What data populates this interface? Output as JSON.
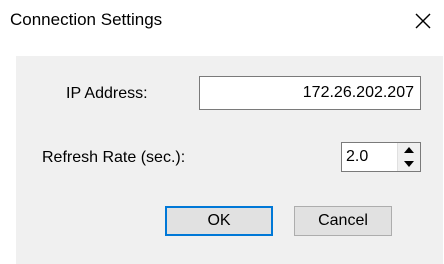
{
  "window": {
    "title": "Connection Settings",
    "close_icon": "close-x-icon"
  },
  "form": {
    "ip_label": "IP Address:",
    "ip_value": "172.26.202.207",
    "refresh_label": "Refresh Rate (sec.):",
    "refresh_value": "2.0",
    "spin_up_icon": "triangle-up-icon",
    "spin_down_icon": "triangle-down-icon"
  },
  "buttons": {
    "ok_label": "OK",
    "cancel_label": "Cancel"
  },
  "colors": {
    "focus_border": "#0078d7",
    "panel_background": "#f0f0f0",
    "button_background": "#e1e1e1"
  }
}
